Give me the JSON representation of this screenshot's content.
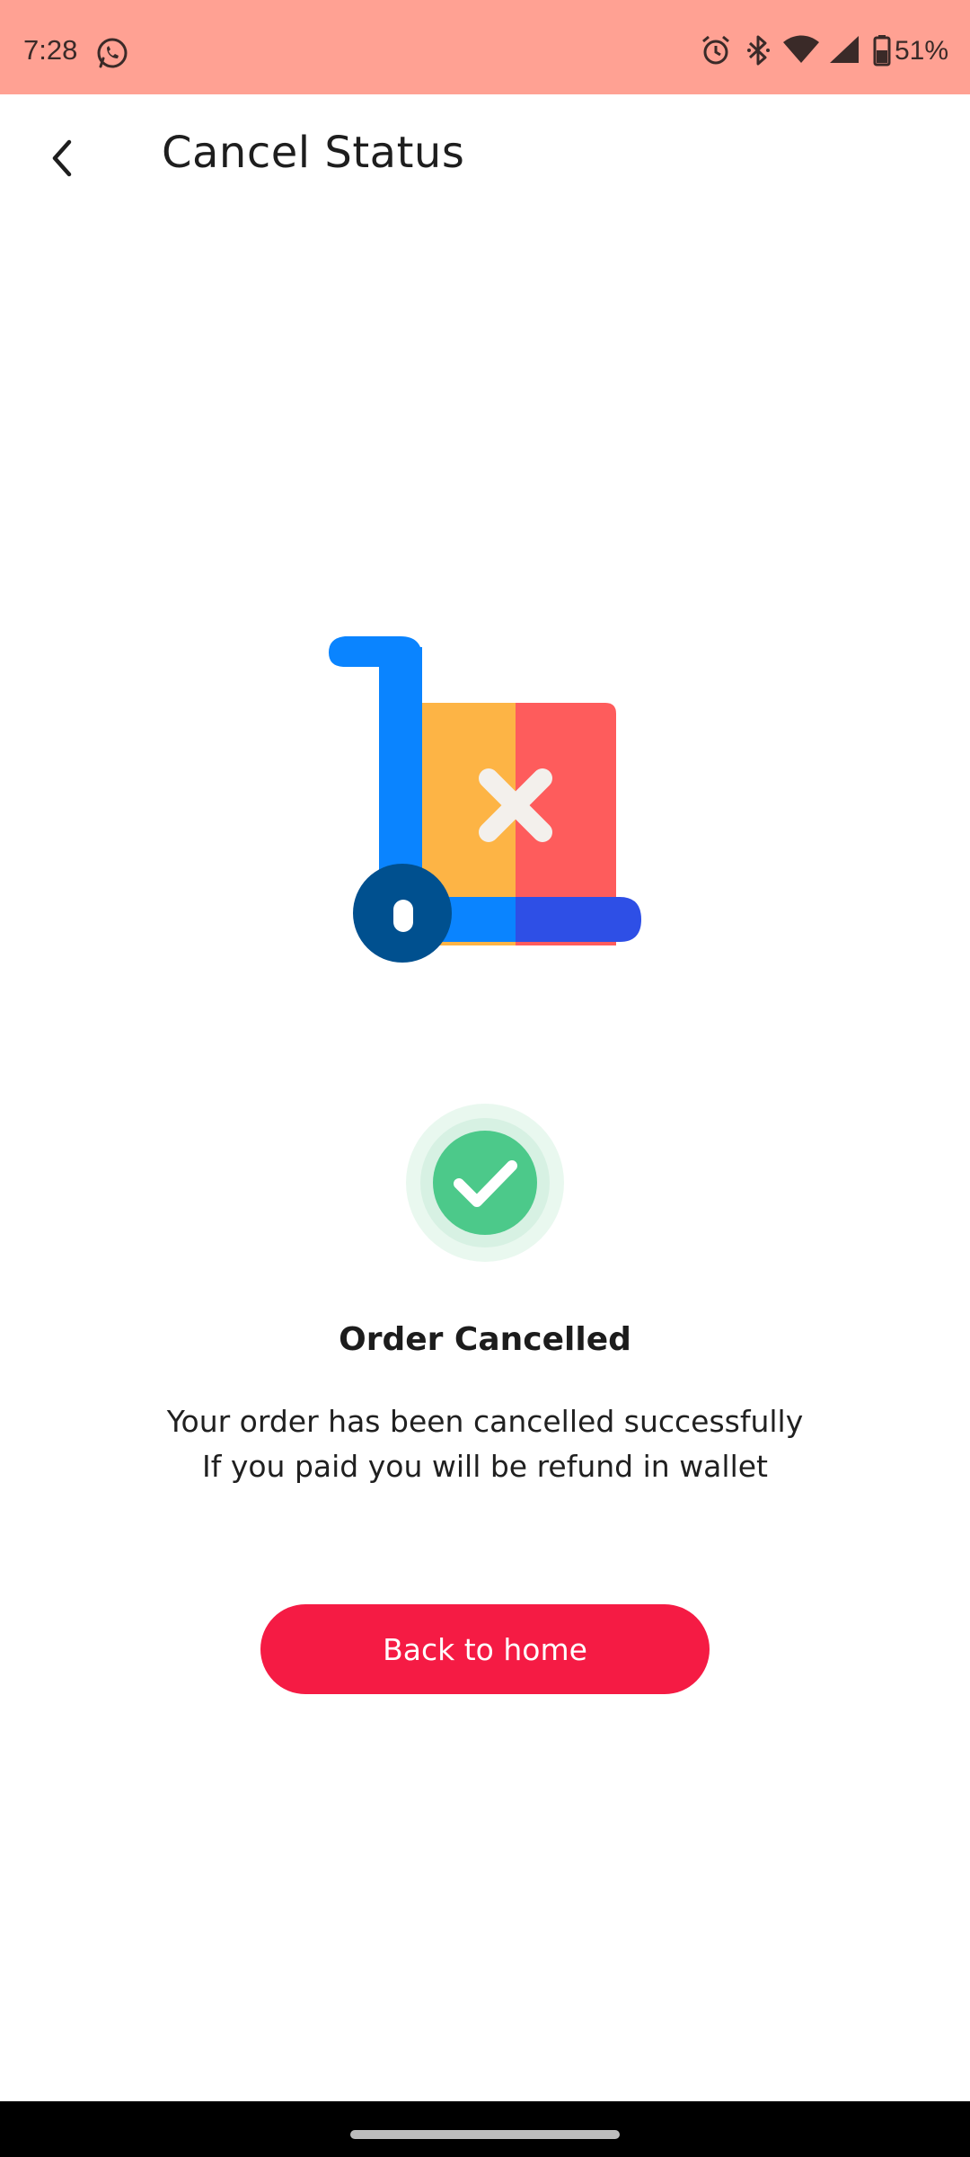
{
  "status_bar": {
    "time": "7:28",
    "battery_percent": "51%",
    "background_color": "#ffa193",
    "icons": [
      "whatsapp-icon",
      "alarm-icon",
      "bluetooth-icon",
      "wifi-icon",
      "signal-icon",
      "battery-icon"
    ]
  },
  "header": {
    "back_icon": "chevron-left-icon",
    "title": "Cancel Status"
  },
  "illustration": {
    "icon": "cancelled-cart-icon",
    "colors": {
      "handle": "#0a84ff",
      "box_left": "#fdb445",
      "box_right": "#fe5c5c",
      "base_right": "#2e4fe6",
      "wheel": "#00508f",
      "cross": "#f3f0ec"
    }
  },
  "status": {
    "icon": "check-circle-icon",
    "icon_color": "#4cc98a",
    "heading": "Order Cancelled",
    "message_line_1": "Your order has been cancelled successfully",
    "message_line_2": "If you paid you will be refund in wallet"
  },
  "actions": {
    "back_home_label": "Back to home",
    "button_color": "#f51b44"
  }
}
